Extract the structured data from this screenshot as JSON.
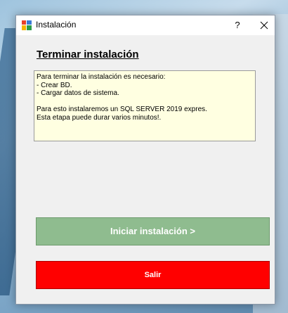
{
  "window": {
    "title": "Instalación",
    "help_label": "?"
  },
  "heading": "Terminar instalación",
  "info": {
    "lines": [
      "Para terminar la instalación es necesario:",
      "- Crear BD.",
      "- Cargar datos de sistema.",
      "",
      "Para esto instalaremos un SQL SERVER 2019 expres.",
      "Esta etapa puede durar varios minutos!."
    ]
  },
  "buttons": {
    "start_label": "Iniciar instalación >",
    "exit_label": "Salir"
  },
  "colors": {
    "start_bg": "#8fbc8f",
    "exit_bg": "#ff0000",
    "info_bg": "#ffffe1"
  }
}
